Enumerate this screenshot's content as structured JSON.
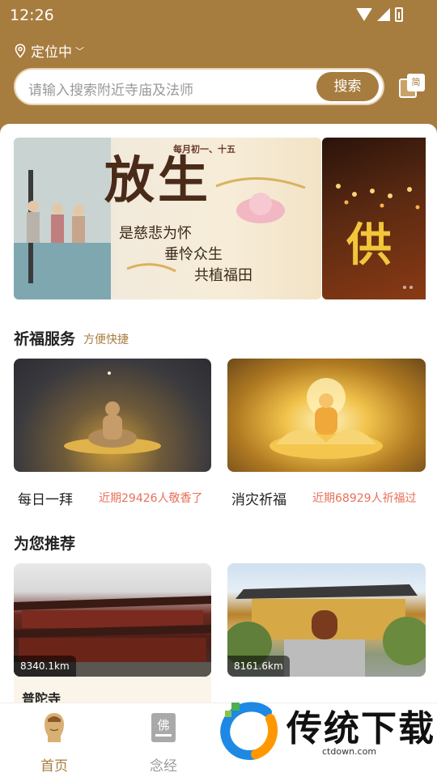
{
  "status_bar": {
    "time": "12:26"
  },
  "header": {
    "location": "定位中",
    "search_placeholder": "请输入搜索附近寺庙及法师",
    "search_button": "搜索",
    "lang_toggle": "简"
  },
  "banner": {
    "title": "放生",
    "subtitle": "每月初一、十五",
    "lines": [
      "是慈悲为怀",
      "垂怜众生",
      "共植福田"
    ],
    "side_title": "供"
  },
  "blessing": {
    "title": "祈福服务",
    "subtitle": "方便快捷",
    "items": [
      {
        "name": "每日一拜",
        "stat": "近期29426人敬香了"
      },
      {
        "name": "消灾祈福",
        "stat": "近期68929人祈福过"
      }
    ]
  },
  "recommend": {
    "title": "为您推荐",
    "items": [
      {
        "distance": "8340.1km",
        "name": "普陀寺"
      },
      {
        "distance": "8161.6km",
        "name": ""
      }
    ]
  },
  "tabbar": {
    "tabs": [
      {
        "label": "首页",
        "active": true
      },
      {
        "label": "念经",
        "active": false
      }
    ]
  },
  "watermark": {
    "text": "传统下载",
    "url": "ctdown.com"
  },
  "colors": {
    "brand": "#a77c3f",
    "stat": "#e8705a"
  }
}
